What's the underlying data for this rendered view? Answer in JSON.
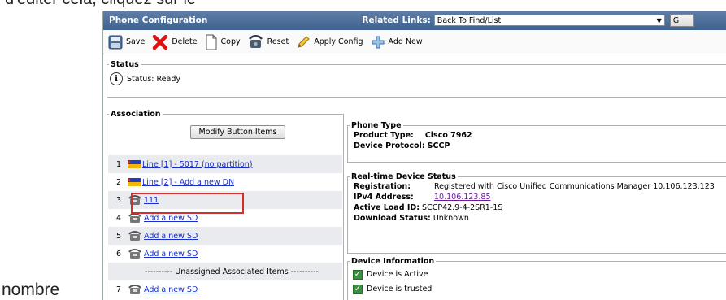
{
  "overlay": {
    "top_text": "d'éditer cela, cliquez sur le",
    "bottom_text": "nombre"
  },
  "window": {
    "title": "Phone Configuration",
    "related_links_label": "Related Links:",
    "related_links_value": "Back To Find/List",
    "go_label": "G"
  },
  "toolbar": {
    "save": "Save",
    "delete": "Delete",
    "copy": "Copy",
    "reset": "Reset",
    "apply_config": "Apply Config",
    "add_new": "Add New"
  },
  "status": {
    "legend": "Status",
    "text": "Status: Ready"
  },
  "association": {
    "legend": "Association",
    "modify_button": "Modify Button Items",
    "unassigned_text": "---------- Unassigned Associated Items ----------",
    "rows": [
      {
        "num": "1",
        "icon": "line-icon",
        "label": "Line [1] - 5017 (no partition)"
      },
      {
        "num": "2",
        "icon": "line-icon",
        "label": "Line [2] - Add a new DN"
      },
      {
        "num": "3",
        "icon": "speed-dial-icon",
        "label": "111"
      },
      {
        "num": "4",
        "icon": "speed-dial-icon",
        "label": "Add a new SD"
      },
      {
        "num": "5",
        "icon": "speed-dial-icon",
        "label": "Add a new SD"
      },
      {
        "num": "6",
        "icon": "speed-dial-icon",
        "label": "Add a new SD"
      },
      {
        "num": "7",
        "icon": "speed-dial-icon",
        "label": "Add a new SD"
      }
    ]
  },
  "phone_type": {
    "legend": "Phone Type",
    "product_label": "Product Type:",
    "product_value": "Cisco 7962",
    "protocol_label": "Device Protocol:",
    "protocol_value": "SCCP"
  },
  "realtime": {
    "legend": "Real-time Device Status",
    "registration_label": "Registration:",
    "registration_value": "Registered with Cisco Unified Communications Manager 10.106.123.123",
    "ipv4_label": "IPv4 Address:",
    "ipv4_value": "10.106.123.85",
    "load_label": "Active Load ID:",
    "load_value": "SCCP42.9-4-2SR1-1S",
    "download_label": "Download Status:",
    "download_value": "Unknown"
  },
  "device_info": {
    "legend": "Device Information",
    "active": "Device is Active",
    "trusted": "Device is trusted"
  },
  "colors": {
    "title_bar": "#3f6190",
    "link": "#1a2ec8",
    "highlight": "#d32f2f",
    "checkbox": "#3e8e41"
  }
}
